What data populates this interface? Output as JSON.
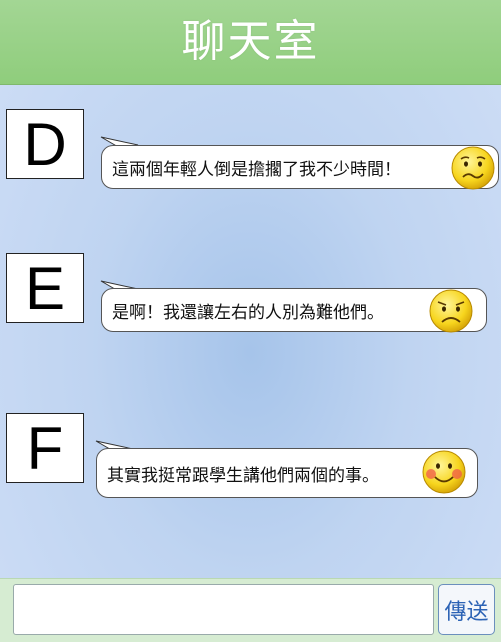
{
  "header": {
    "title": "聊天室"
  },
  "messages": [
    {
      "avatar_letter": "D",
      "text": "這兩個年輕人倒是擔擱了我不少時間！",
      "emoji": "confused-face-icon"
    },
    {
      "avatar_letter": "E",
      "text": "是啊！我還讓左右的人別為難他們。",
      "emoji": "sad-face-icon"
    },
    {
      "avatar_letter": "F",
      "text": "其實我挺常跟學生講他們兩個的事。",
      "emoji": "blushing-smile-icon"
    }
  ],
  "composer": {
    "input_value": "",
    "send_label": "傳送"
  },
  "colors": {
    "header": "#9bd389",
    "background": "#bfd4f1",
    "footer": "#d6ecd2",
    "send_text": "#2c63b5",
    "emoji_fill": "#f7d51d"
  }
}
